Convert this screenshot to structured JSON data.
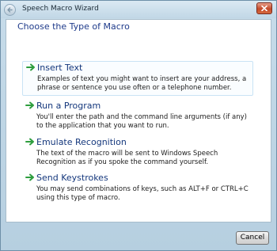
{
  "window": {
    "title": "Speech Macro Wizard"
  },
  "page": {
    "heading": "Choose the Type of Macro"
  },
  "options": [
    {
      "title": "Insert Text",
      "description": "Examples of text you might want to insert are your address, a phrase or sentence you use often or a telephone number."
    },
    {
      "title": "Run a Program",
      "description": "You'll enter the path and the command line arguments (if any) to the application that you want to run."
    },
    {
      "title": "Emulate Recognition",
      "description": "The text of the macro will be sent to Windows Speech Recognition as if you spoke the command yourself."
    },
    {
      "title": "Send Keystrokes",
      "description": "You may send combinations of keys, such as ALT+F or CTRL+C using this type of macro."
    }
  ],
  "footer": {
    "cancel_label": "Cancel"
  },
  "icons": {
    "back": "back-arrow-icon",
    "close": "close-icon",
    "option_arrow": "green-arrow-icon"
  },
  "colors": {
    "heading": "#1e3a8a",
    "option_title": "#14377c",
    "arrow_green": "#2e9e3e",
    "close_red": "#c44a2a"
  }
}
